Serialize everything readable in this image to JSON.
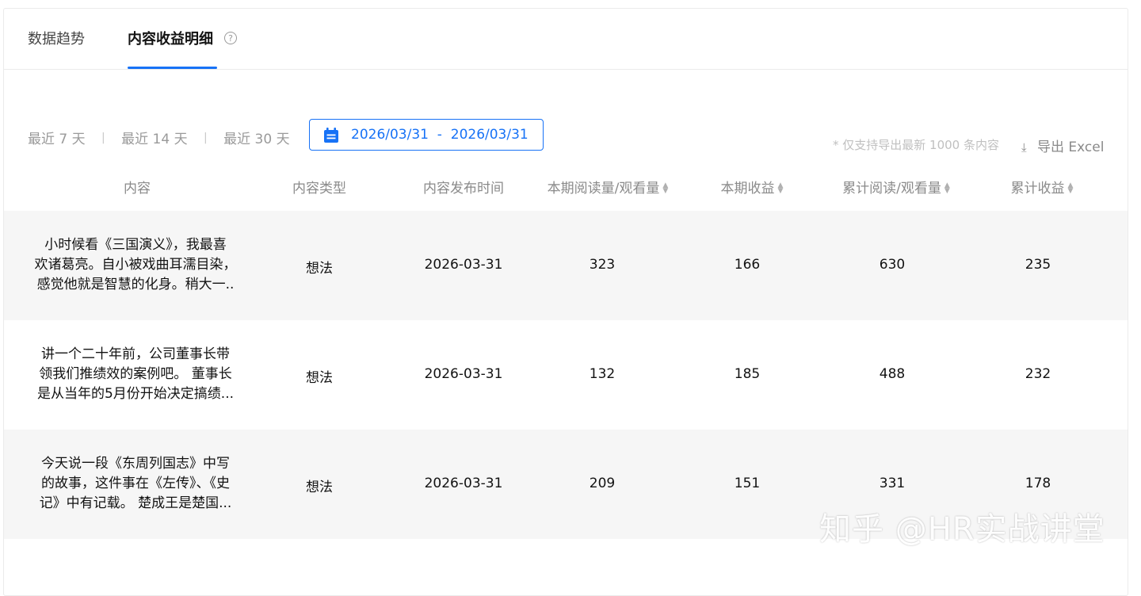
{
  "tabs": [
    {
      "label": "数据趋势",
      "active": false
    },
    {
      "label": "内容收益明细",
      "active": true
    }
  ],
  "help_icon": "question-circle-icon",
  "filters": {
    "options": [
      "最近 7 天",
      "最近 14 天",
      "最近 30 天"
    ],
    "separator": "|",
    "date_range": {
      "start": "2026/03/31",
      "separator": "-",
      "end": "2026/03/31",
      "icon": "calendar-icon"
    }
  },
  "export": {
    "note": "* 仅支持导出最新 1000 条内容",
    "label": "导出 Excel",
    "icon": "download-icon"
  },
  "table": {
    "columns": [
      {
        "label": "内容",
        "sortable": false
      },
      {
        "label": "内容类型",
        "sortable": false
      },
      {
        "label": "内容发布时间",
        "sortable": false
      },
      {
        "label": "本期阅读量/观看量",
        "sortable": true
      },
      {
        "label": "本期收益",
        "sortable": true
      },
      {
        "label": "累计阅读/观看量",
        "sortable": true
      },
      {
        "label": "累计收益",
        "sortable": true
      }
    ],
    "rows": [
      {
        "content": [
          "小时候看《三国演义》，我最喜",
          "欢诸葛亮。自小被戏曲耳濡目染，",
          "感觉他就是智慧的化身。稍大一.."
        ],
        "type": "想法",
        "date": "2026-03-31",
        "period_views": "323",
        "period_income": "166",
        "total_views": "630",
        "total_income": "235"
      },
      {
        "content": [
          "讲一个二十年前，公司董事长带",
          "领我们推绩效的案例吧。 董事长",
          "是从当年的5月份开始决定搞绩..."
        ],
        "type": "想法",
        "date": "2026-03-31",
        "period_views": "132",
        "period_income": "185",
        "total_views": "488",
        "total_income": "232"
      },
      {
        "content": [
          "今天说一段《东周列国志》中写",
          "的故事，这件事在《左传》、《史",
          "记》中有记载。 楚成王是楚国..."
        ],
        "type": "想法",
        "date": "2026-03-31",
        "period_views": "209",
        "period_income": "151",
        "total_views": "331",
        "total_income": "178"
      }
    ]
  },
  "watermark": "知乎 @HR实战讲堂",
  "colors": {
    "accent": "#1772f6",
    "row_alt": "#f6f6f6"
  }
}
